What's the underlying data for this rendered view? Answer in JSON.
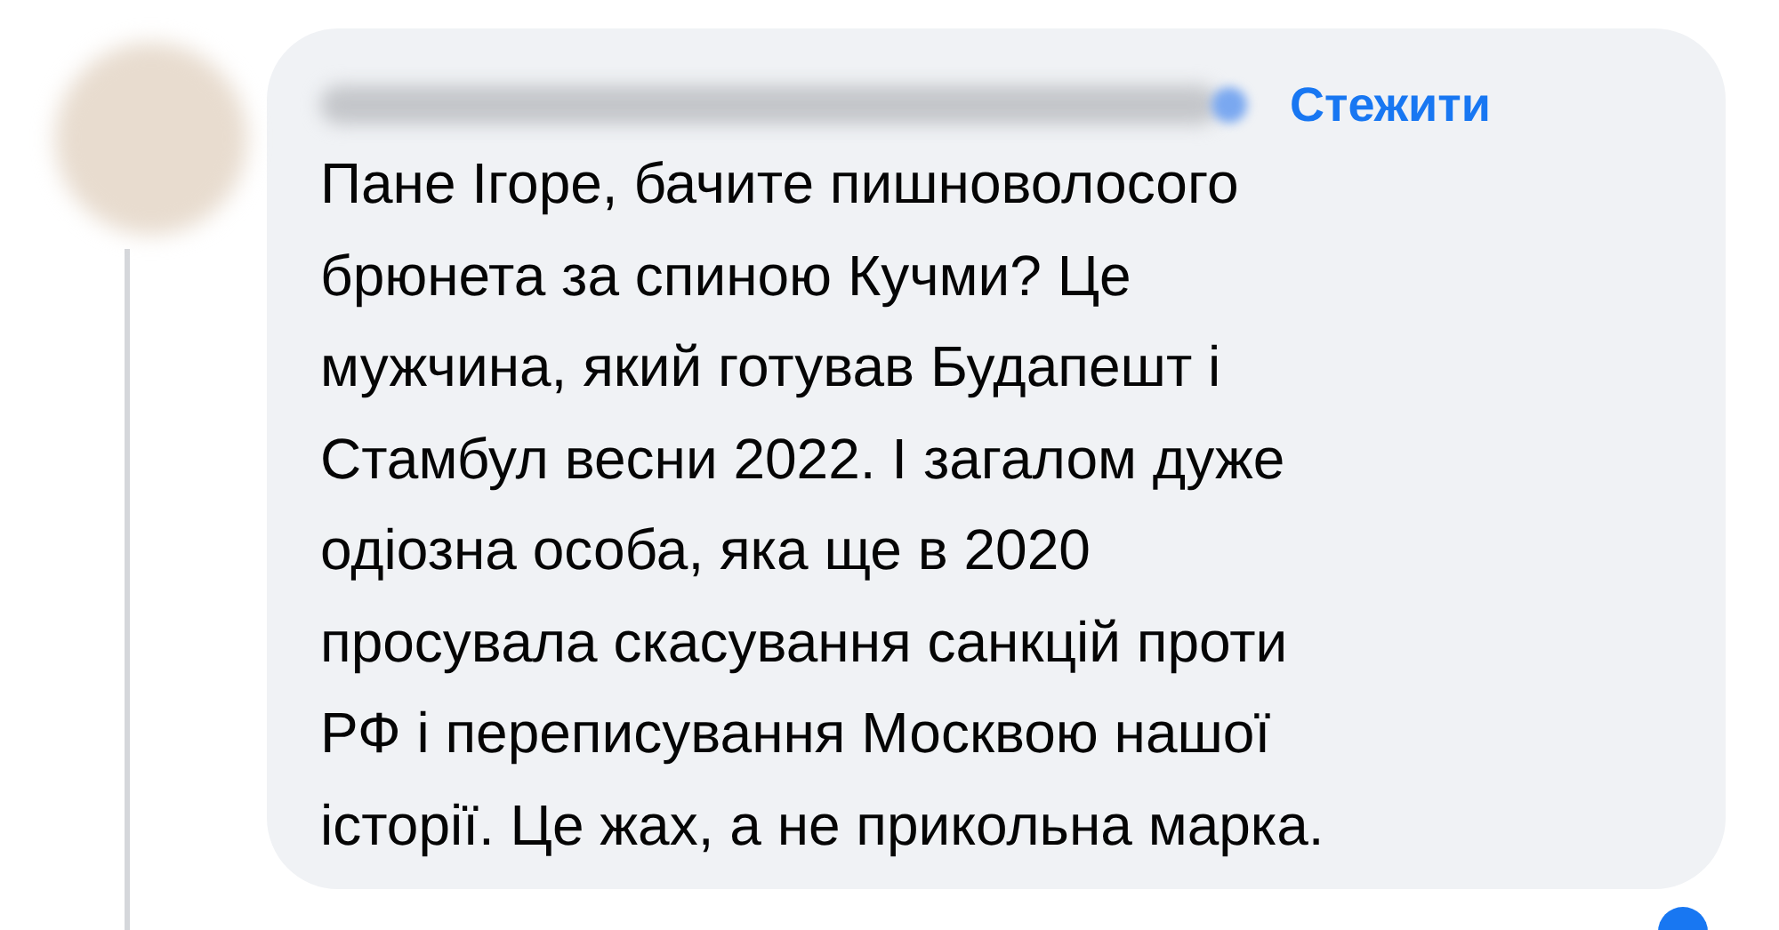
{
  "comment": {
    "follow_link": "Стежити",
    "body_lines": [
      "Пане Ігоре, бачите пишноволосого",
      "брюнета за спиною Кучми? Це",
      "мужчина, який готував Будапешт і",
      "Стамбул весни 2022. І загалом дуже",
      "одіозна особа, яка ще в 2020",
      "просувала скасування санкцій проти",
      "РФ і переписування Москвою нашої",
      "історії. Це жах, а не прикольна марка."
    ]
  }
}
